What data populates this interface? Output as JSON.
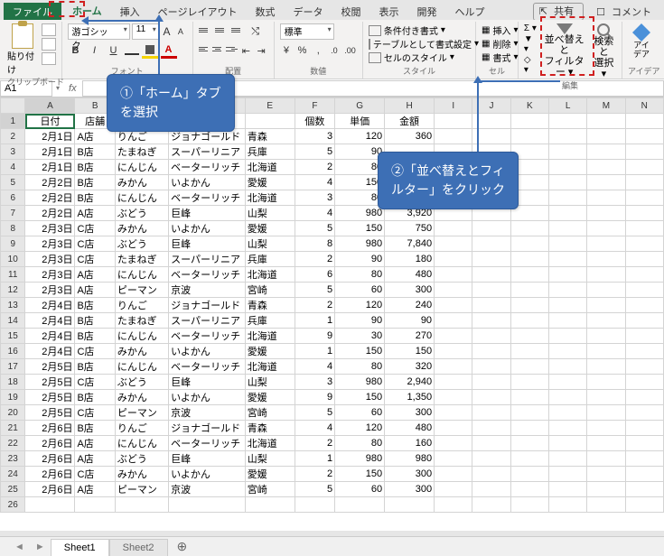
{
  "topright": {
    "share": "共有",
    "comment": "コメント"
  },
  "menu": {
    "file": "ファイル",
    "home": "ホーム",
    "insert": "挿入",
    "page_layout": "ページレイアウト",
    "formulas": "数式",
    "data": "データ",
    "review": "校閲",
    "view": "表示",
    "developer": "開発",
    "help": "ヘルプ"
  },
  "ribbon": {
    "clipboard": {
      "paste": "貼り付け",
      "label": "クリップボード"
    },
    "font": {
      "name": "游ゴシック",
      "size": "11",
      "bold": "B",
      "italic": "I",
      "underline": "U",
      "color_letter": "A",
      "aa_up": "A",
      "aa_down": "A",
      "label": "フォント"
    },
    "align": {
      "wrap": "折り返して全体を表示する",
      "merge": "セルを結合して中央揃え",
      "label": "配置"
    },
    "number": {
      "format": "標準",
      "label": "数値"
    },
    "styles": {
      "cond": "条件付き書式",
      "table": "テーブルとして書式設定",
      "cell": "セルのスタイル",
      "label": "スタイル"
    },
    "cells": {
      "insert": "挿入",
      "delete": "削除",
      "format": "書式",
      "label": "セル"
    },
    "editing": {
      "sigma": "Σ",
      "fill": "▾",
      "clear": "◇",
      "sort": "並べ替えと",
      "sort2": "フィルター",
      "drop": "▾",
      "find": "検索と",
      "find2": "選択",
      "drop2": "▾",
      "label": "編集"
    },
    "ideas": {
      "label": "アイデア",
      "text": "アイ\nデア"
    }
  },
  "namebox": "A1",
  "headers": [
    "日付",
    "店舗",
    "",
    "",
    "",
    "個数",
    "単価",
    "金額"
  ],
  "cols_right": [
    "I",
    "J",
    "K",
    "L",
    "M",
    "N"
  ],
  "rows": [
    [
      "2月1日",
      "A店",
      "りんご",
      "ジョナゴールド",
      "青森",
      "3",
      "120",
      "360"
    ],
    [
      "2月1日",
      "B店",
      "たまねぎ",
      "スーパーリニア",
      "兵庫",
      "5",
      "90",
      ""
    ],
    [
      "2月1日",
      "B店",
      "にんじん",
      "ベーターリッチ",
      "北海道",
      "2",
      "80",
      ""
    ],
    [
      "2月2日",
      "B店",
      "みかん",
      "いよかん",
      "愛媛",
      "4",
      "150",
      ""
    ],
    [
      "2月2日",
      "B店",
      "にんじん",
      "ベーターリッチ",
      "北海道",
      "3",
      "80",
      ""
    ],
    [
      "2月2日",
      "A店",
      "ぶどう",
      "巨峰",
      "山梨",
      "4",
      "980",
      "3,920"
    ],
    [
      "2月3日",
      "C店",
      "みかん",
      "いよかん",
      "愛媛",
      "5",
      "150",
      "750"
    ],
    [
      "2月3日",
      "C店",
      "ぶどう",
      "巨峰",
      "山梨",
      "8",
      "980",
      "7,840"
    ],
    [
      "2月3日",
      "C店",
      "たまねぎ",
      "スーパーリニア",
      "兵庫",
      "2",
      "90",
      "180"
    ],
    [
      "2月3日",
      "A店",
      "にんじん",
      "ベーターリッチ",
      "北海道",
      "6",
      "80",
      "480"
    ],
    [
      "2月3日",
      "A店",
      "ピーマン",
      "京波",
      "宮崎",
      "5",
      "60",
      "300"
    ],
    [
      "2月4日",
      "B店",
      "りんご",
      "ジョナゴールド",
      "青森",
      "2",
      "120",
      "240"
    ],
    [
      "2月4日",
      "B店",
      "たまねぎ",
      "スーパーリニア",
      "兵庫",
      "1",
      "90",
      "90"
    ],
    [
      "2月4日",
      "B店",
      "にんじん",
      "ベーターリッチ",
      "北海道",
      "9",
      "30",
      "270"
    ],
    [
      "2月4日",
      "C店",
      "みかん",
      "いよかん",
      "愛媛",
      "1",
      "150",
      "150"
    ],
    [
      "2月5日",
      "B店",
      "にんじん",
      "ベーターリッチ",
      "北海道",
      "4",
      "80",
      "320"
    ],
    [
      "2月5日",
      "C店",
      "ぶどう",
      "巨峰",
      "山梨",
      "3",
      "980",
      "2,940"
    ],
    [
      "2月5日",
      "B店",
      "みかん",
      "いよかん",
      "愛媛",
      "9",
      "150",
      "1,350"
    ],
    [
      "2月5日",
      "C店",
      "ピーマン",
      "京波",
      "宮崎",
      "5",
      "60",
      "300"
    ],
    [
      "2月6日",
      "B店",
      "りんご",
      "ジョナゴールド",
      "青森",
      "4",
      "120",
      "480"
    ],
    [
      "2月6日",
      "A店",
      "にんじん",
      "ベーターリッチ",
      "北海道",
      "2",
      "80",
      "160"
    ],
    [
      "2月6日",
      "A店",
      "ぶどう",
      "巨峰",
      "山梨",
      "1",
      "980",
      "980"
    ],
    [
      "2月6日",
      "C店",
      "みかん",
      "いよかん",
      "愛媛",
      "2",
      "150",
      "300"
    ],
    [
      "2月6日",
      "A店",
      "ピーマン",
      "京波",
      "宮崎",
      "5",
      "60",
      "300"
    ]
  ],
  "sheets": {
    "s1": "Sheet1",
    "s2": "Sheet2"
  },
  "callouts": {
    "c1": "①「ホーム」タブ\nを選択",
    "c2": "②「並べ替えとフィ\nルター」をクリック"
  }
}
